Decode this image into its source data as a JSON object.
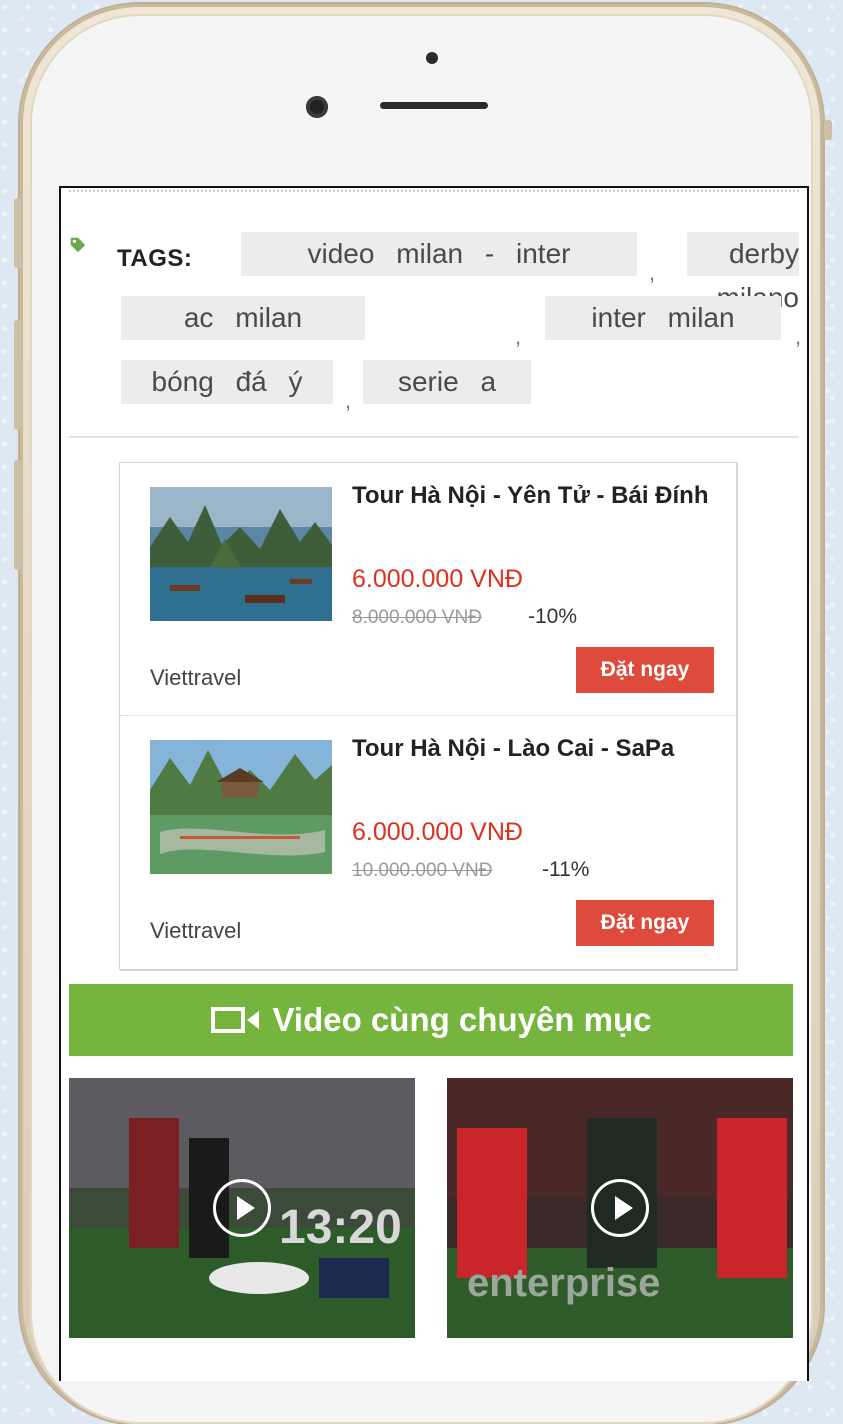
{
  "tags": {
    "label": "TAGS:",
    "items": [
      "video milan - inter",
      "derby milano",
      "ac milan",
      "inter milan",
      "bóng đá ý",
      "serie a"
    ],
    "separator": ","
  },
  "tours": [
    {
      "title": "Tour Hà Nội - Yên Tử - Bái Đính",
      "price": "6.000.000 VNĐ",
      "old_price": "8.000.000 VNĐ",
      "discount": "-10%",
      "provider": "Viettravel",
      "button": "Đặt ngay"
    },
    {
      "title": "Tour Hà Nội - Lào Cai - SaPa",
      "price": "6.000.000 VNĐ",
      "old_price": "10.000.000 VNĐ",
      "discount": "-11%",
      "provider": "Viettravel",
      "button": "Đặt ngay"
    }
  ],
  "video_section": {
    "title": "Video cùng chuyên mục",
    "icon": "video-camera-icon"
  },
  "videos": [
    {
      "thumb_text": "13:20",
      "icon": "play-icon"
    },
    {
      "thumb_text": "enterprise",
      "icon": "play-icon"
    }
  ],
  "colors": {
    "accent_green": "#75b53d",
    "price_red": "#e0301e",
    "button_red": "#de4b3d",
    "tag_bg": "#ececec"
  }
}
